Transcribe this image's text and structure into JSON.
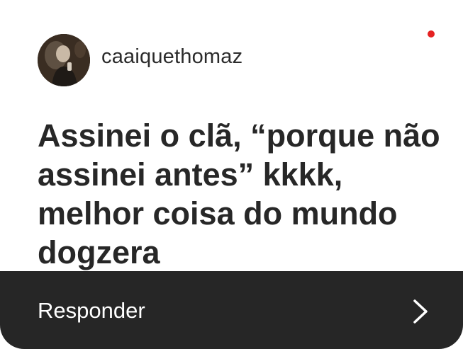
{
  "post": {
    "username": "caaiquethomaz",
    "avatar_icon": "user-avatar-photo",
    "unread_indicator_color": "#e52222",
    "message": "Assinei o clã, “porque não assinei antes” kkkk, melhor coisa do mundo dogzera"
  },
  "reply": {
    "label": "Responder",
    "icon": "chevron-right-icon",
    "bar_color": "#262626"
  }
}
